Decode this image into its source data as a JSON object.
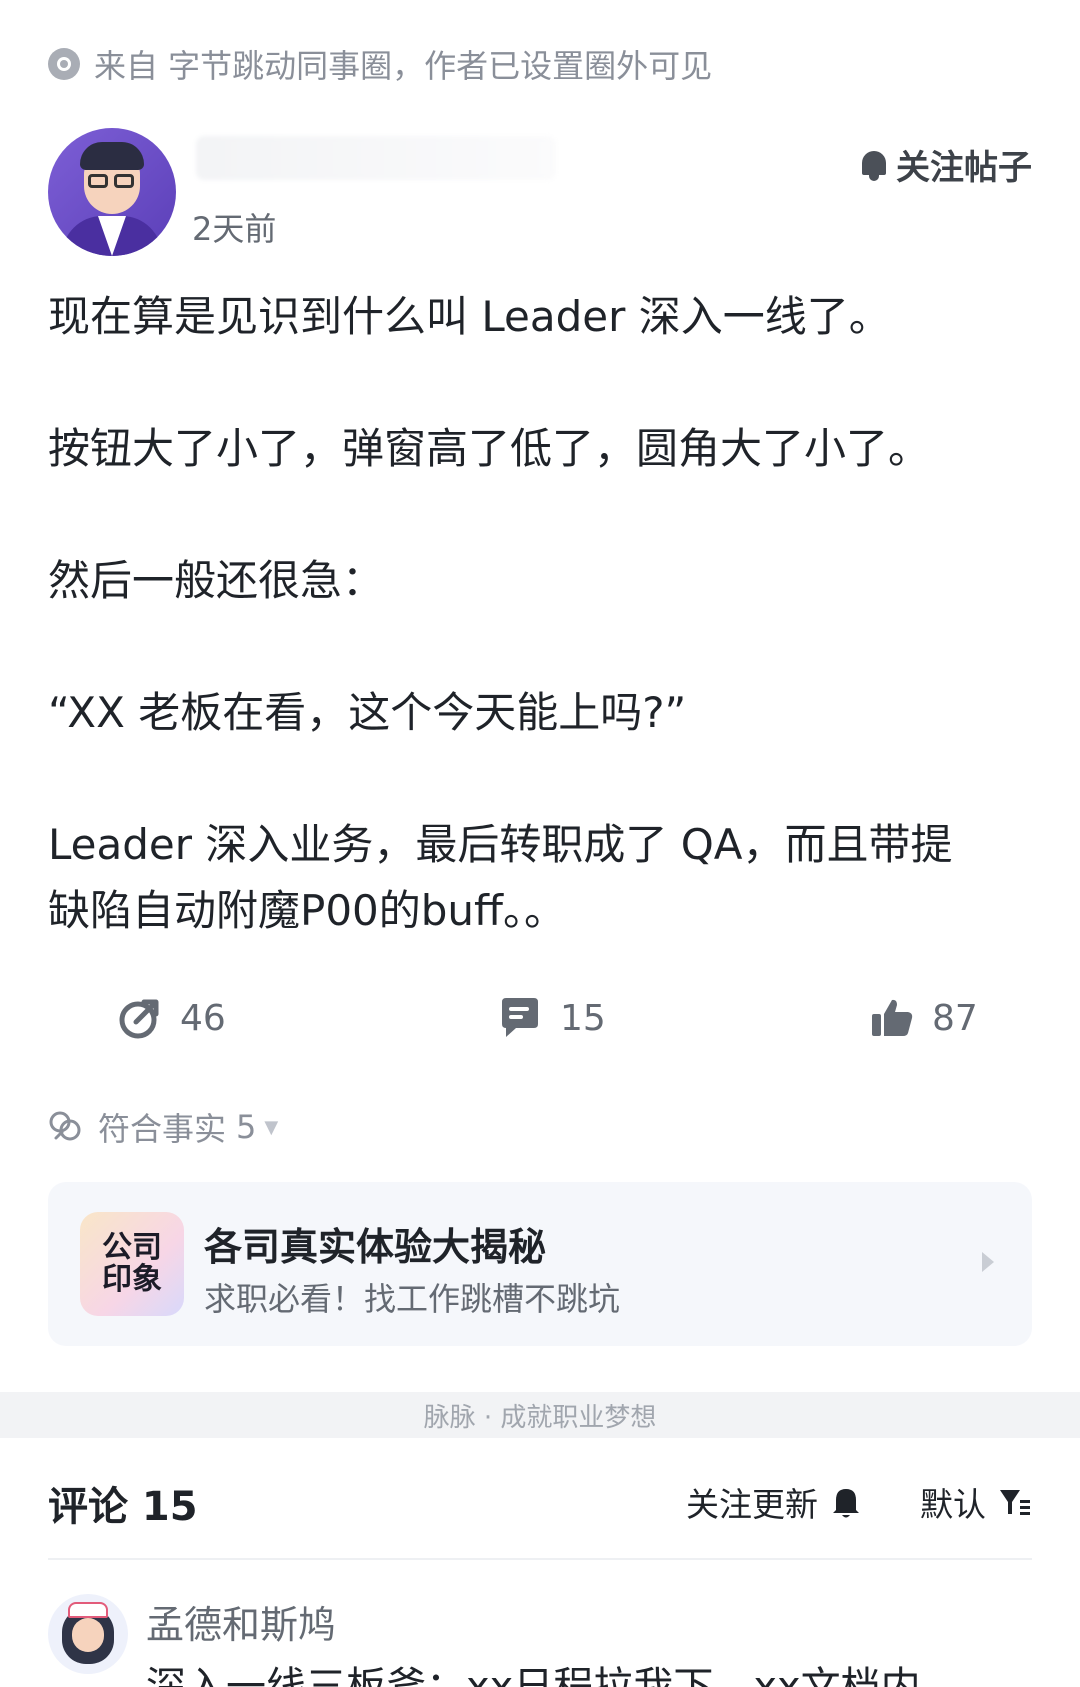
{
  "source": {
    "text": "来自 字节跳动同事圈，作者已设置圈外可见"
  },
  "post": {
    "time": "2天前",
    "follow_label": "关注帖子",
    "paragraphs": [
      "现在算是见识到什么叫 Leader 深入一线了。",
      "按钮大了小了，弹窗高了低了，圆角大了小了。",
      "然后一般还很急：",
      "“XX 老板在看，这个今天能上吗?”",
      "Leader 深入业务，最后转职成了 QA，而且带提",
      "缺陷自动附魔P00的buff。。"
    ]
  },
  "actions": {
    "share_count": "46",
    "comment_count": "15",
    "like_count": "87"
  },
  "fact": {
    "label": "符合事实",
    "count": "5"
  },
  "promo": {
    "logo_line1": "公司",
    "logo_line2": "印象",
    "title": "各司真实体验大揭秘",
    "subtitle": "求职必看！找工作跳槽不跳坑"
  },
  "footer": {
    "text": "脉脉 · 成就职业梦想"
  },
  "comments": {
    "title": "评论 15",
    "follow_updates": "关注更新",
    "sort": "默认",
    "items": [
      {
        "author": "孟德和斯鸠",
        "text": "深入一线三板斧：xx日程拉我下，xx文档内"
      }
    ]
  },
  "colors": {
    "text_primary": "#1f2329",
    "text_secondary": "#646a73",
    "text_muted": "#8a8f99",
    "card_bg": "#f5f7fb",
    "band_bg": "#f2f3f5"
  }
}
